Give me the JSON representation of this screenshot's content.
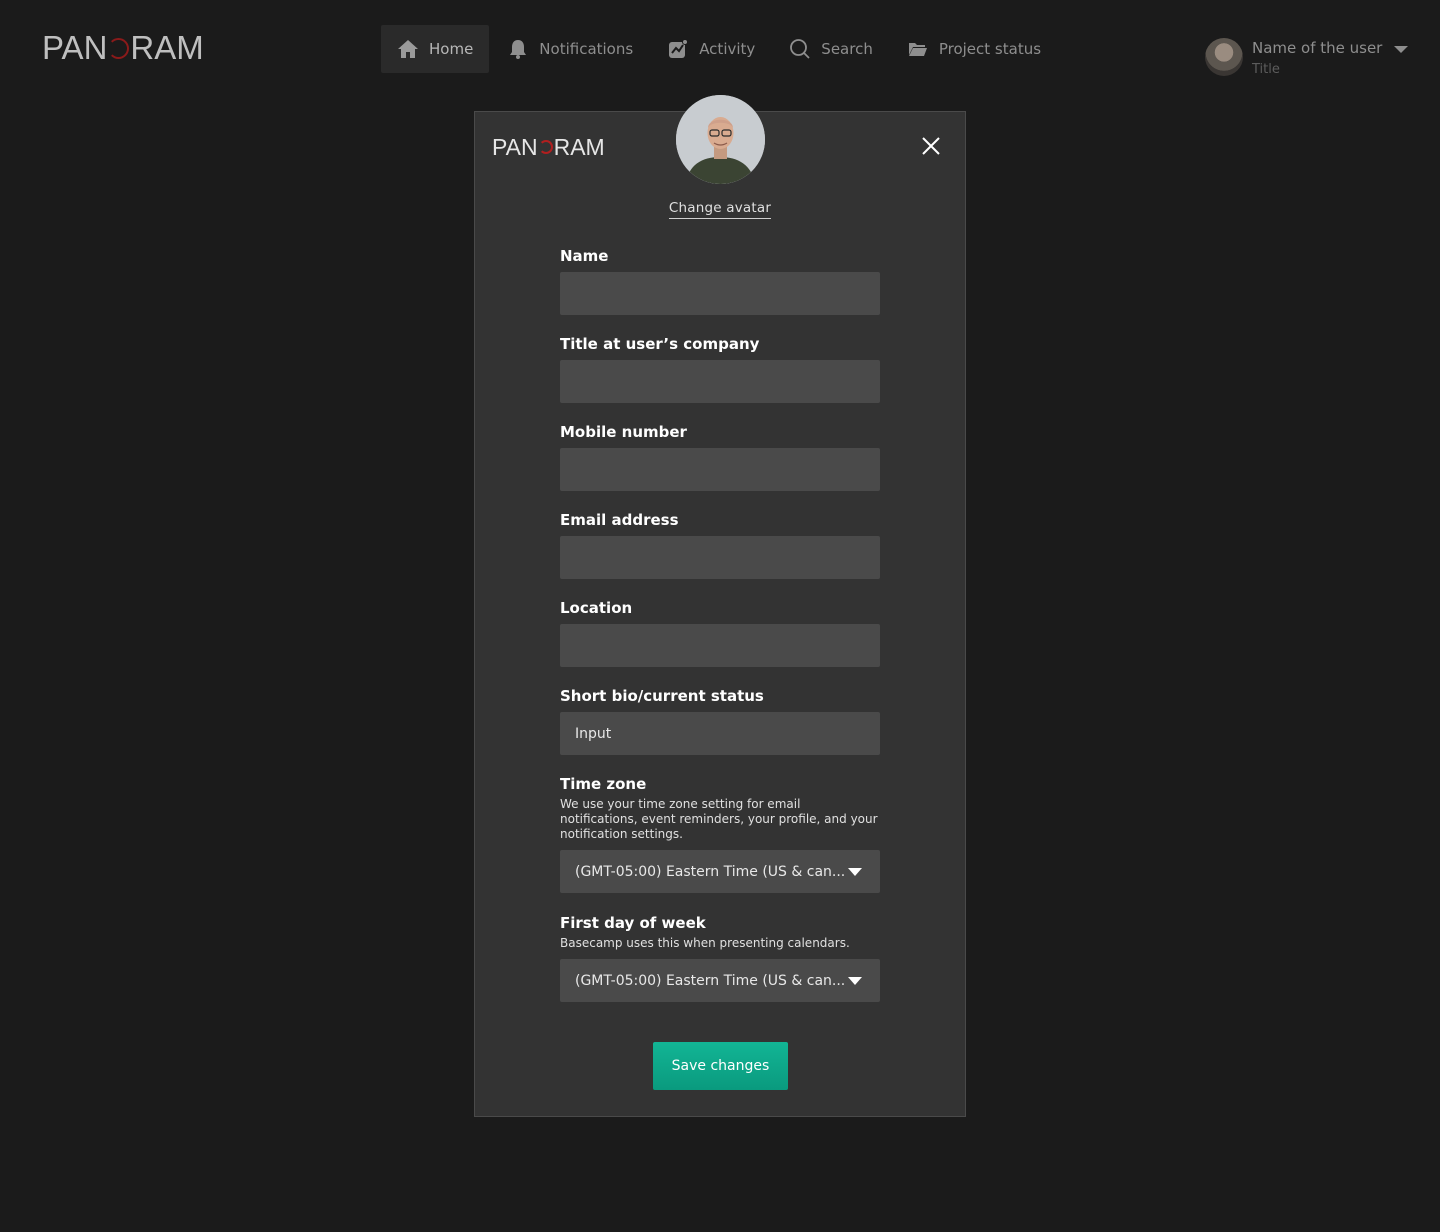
{
  "app": {
    "logo_text_left": "PAN",
    "logo_text_right": "RAM"
  },
  "nav": {
    "items": [
      {
        "label": "Home",
        "icon": "home-icon",
        "active": true
      },
      {
        "label": "Notifications",
        "icon": "bell-icon",
        "active": false
      },
      {
        "label": "Activity",
        "icon": "activity-icon",
        "active": false
      },
      {
        "label": "Search",
        "icon": "search-icon",
        "active": false
      },
      {
        "label": "Project status",
        "icon": "folder-icon",
        "active": false
      }
    ]
  },
  "user": {
    "name": "Name of the user",
    "title": "Title"
  },
  "modal": {
    "change_avatar": "Change avatar",
    "fields": {
      "name": {
        "label": "Name",
        "value": ""
      },
      "title": {
        "label": "Title at user’s company",
        "value": ""
      },
      "mobile": {
        "label": "Mobile number",
        "value": ""
      },
      "email": {
        "label": "Email address",
        "value": ""
      },
      "location": {
        "label": "Location",
        "value": ""
      },
      "bio": {
        "label": "Short bio/current status",
        "value": "Input"
      },
      "timezone": {
        "label": "Time zone",
        "help": "We use your time zone setting for email notifications, event reminders, your profile, and your notification settings.",
        "value": "(GMT-05:00) Eastern Time (US & can..."
      },
      "first_day": {
        "label": "First day of week",
        "help": "Basecamp uses this when presenting calendars.",
        "value": "(GMT-05:00) Eastern Time (US & can..."
      }
    },
    "save_label": "Save changes"
  },
  "colors": {
    "background": "#1b1b1b",
    "modal": "#333333",
    "input": "#4a4a4a",
    "accent": "#0fa98a",
    "logo_accent": "#b11f1f"
  }
}
